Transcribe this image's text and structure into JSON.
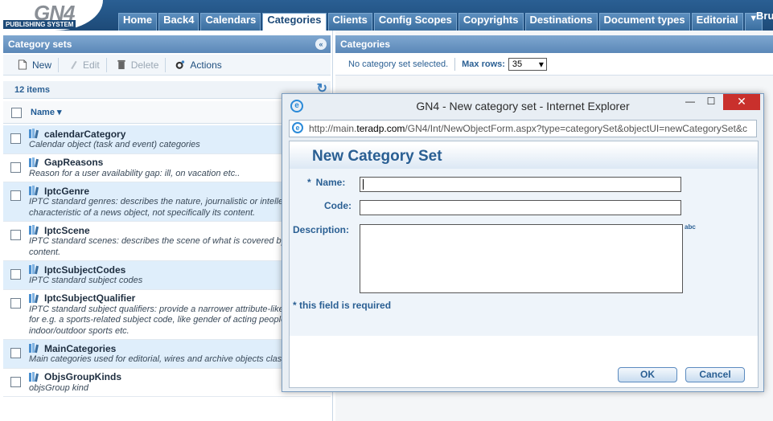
{
  "app": {
    "logo_text": "GN4",
    "logo_subtitle": "PUBLISHING SYSTEM",
    "tabs": [
      "Home",
      "Back4",
      "Calendars",
      "Categories",
      "Clients",
      "Config Scopes",
      "Copyrights",
      "Destinations",
      "Document types",
      "Editorial"
    ],
    "active_tab": "Categories",
    "more_tabs": "▼",
    "user_name": "Bru"
  },
  "left_panel": {
    "title": "Category sets",
    "collapse_glyph": "«",
    "toolbar": {
      "new": "New",
      "edit": "Edit",
      "delete": "Delete",
      "actions": "Actions"
    },
    "item_count": "12 items",
    "refresh_glyph": "↻",
    "column_header": "Name ▾",
    "items": [
      {
        "name": "calendarCategory",
        "desc": "Calendar object (task and event) categories"
      },
      {
        "name": "GapReasons",
        "desc": "Reason for a user availability gap: ill, on vacation etc.."
      },
      {
        "name": "IptcGenre",
        "desc": "IPTC standard genres: describes the nature, journalistic or intellectual characteristic of a news object, not specifically its content."
      },
      {
        "name": "IptcScene",
        "desc": "IPTC standard scenes: describes the scene of what is covered by the content."
      },
      {
        "name": "IptcSubjectCodes",
        "desc": "IPTC standard subject codes"
      },
      {
        "name": "IptcSubjectQualifier",
        "desc": "IPTC standard subject qualifiers: provide a narrower attribute-like context for e.g. a sports-related subject code, like gender of acting people, indoor/outdoor sports etc."
      },
      {
        "name": "MainCategories",
        "desc": "Main categories used for editorial, wires and archive objects classification"
      },
      {
        "name": "ObjsGroupKinds",
        "desc": "objsGroup kind"
      }
    ]
  },
  "right_panel": {
    "title": "Categories",
    "status": "No category set selected.",
    "max_rows_label": "Max rows:",
    "max_rows_value": "35"
  },
  "dialog": {
    "window_title": "GN4 - New category set - Internet Explorer",
    "ie_glyph": "e",
    "minimize": "—",
    "maximize": "☐",
    "close": "✕",
    "url_prefix": "http://main.",
    "url_domain": "teradp.com",
    "url_rest": "/GN4/Int/NewObjectForm.aspx?type=categorySet&objectUI=newCategorySet&c",
    "heading": "New Category Set",
    "required_mark": "*",
    "name_label": "Name:",
    "code_label": "Code:",
    "description_label": "Description:",
    "spell_glyph": "abc",
    "required_note": "* this field is required",
    "ok": "OK",
    "cancel": "Cancel"
  }
}
